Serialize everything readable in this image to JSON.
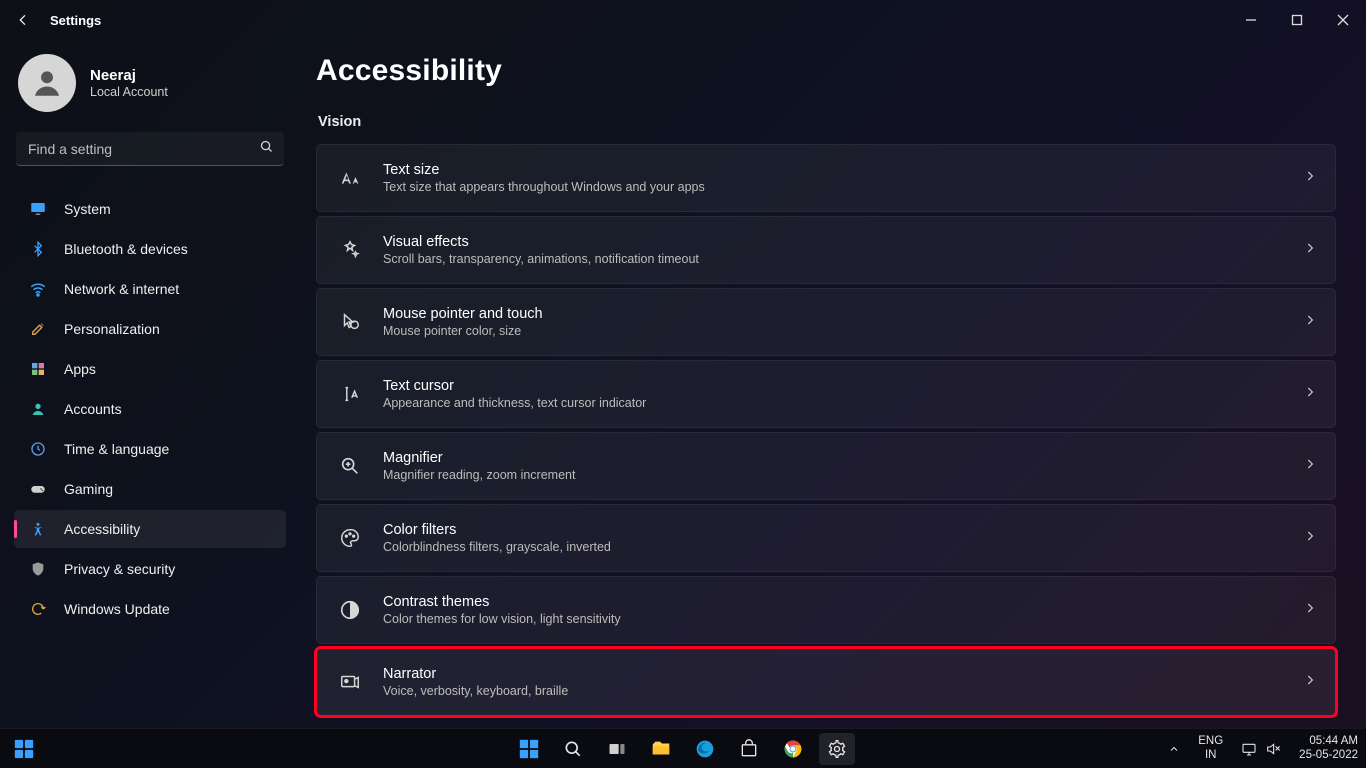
{
  "titlebar": {
    "title": "Settings"
  },
  "user": {
    "name": "Neeraj",
    "subtitle": "Local Account"
  },
  "search": {
    "placeholder": "Find a setting"
  },
  "sidebar": {
    "items": [
      {
        "label": "System",
        "icon": "display"
      },
      {
        "label": "Bluetooth & devices",
        "icon": "bluetooth"
      },
      {
        "label": "Network & internet",
        "icon": "wifi"
      },
      {
        "label": "Personalization",
        "icon": "brush"
      },
      {
        "label": "Apps",
        "icon": "apps"
      },
      {
        "label": "Accounts",
        "icon": "person"
      },
      {
        "label": "Time & language",
        "icon": "clock"
      },
      {
        "label": "Gaming",
        "icon": "game"
      },
      {
        "label": "Accessibility",
        "icon": "access",
        "active": true
      },
      {
        "label": "Privacy & security",
        "icon": "shield"
      },
      {
        "label": "Windows Update",
        "icon": "update"
      }
    ]
  },
  "main": {
    "title": "Accessibility",
    "section": "Vision",
    "cards": [
      {
        "icon": "textsize",
        "title": "Text size",
        "sub": "Text size that appears throughout Windows and your apps"
      },
      {
        "icon": "effects",
        "title": "Visual effects",
        "sub": "Scroll bars, transparency, animations, notification timeout"
      },
      {
        "icon": "mouse",
        "title": "Mouse pointer and touch",
        "sub": "Mouse pointer color, size"
      },
      {
        "icon": "cursor",
        "title": "Text cursor",
        "sub": "Appearance and thickness, text cursor indicator"
      },
      {
        "icon": "magnify",
        "title": "Magnifier",
        "sub": "Magnifier reading, zoom increment"
      },
      {
        "icon": "palette",
        "title": "Color filters",
        "sub": "Colorblindness filters, grayscale, inverted"
      },
      {
        "icon": "contrast",
        "title": "Contrast themes",
        "sub": "Color themes for low vision, light sensitivity"
      },
      {
        "icon": "narrator",
        "title": "Narrator",
        "sub": "Voice, verbosity, keyboard, braille",
        "highlight": true
      }
    ]
  },
  "taskbar": {
    "lang1": "ENG",
    "lang2": "IN",
    "time": "05:44 AM",
    "date": "25-05-2022"
  }
}
